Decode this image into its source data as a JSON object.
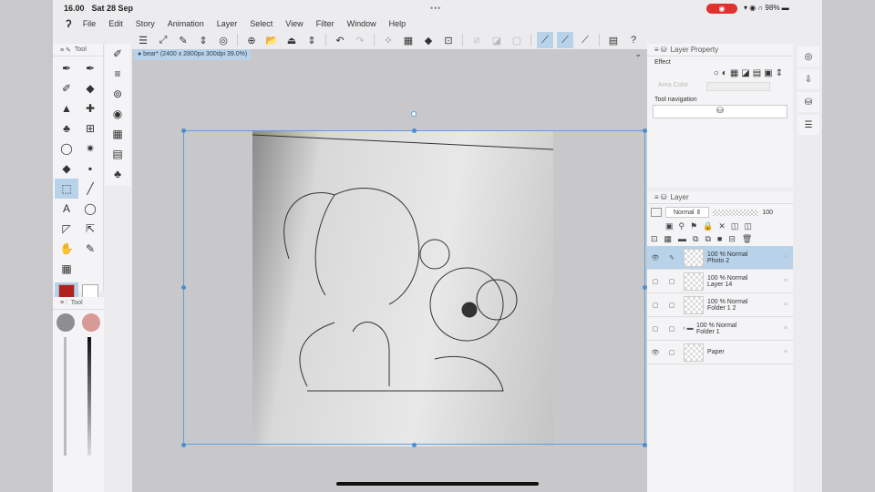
{
  "status": {
    "time": "16.00",
    "date": "Sat 28 Sep",
    "dots": "•••",
    "battery": "98%",
    "record": "◉"
  },
  "menu": [
    "File",
    "Edit",
    "Story",
    "Animation",
    "Layer",
    "Select",
    "View",
    "Filter",
    "Window",
    "Help"
  ],
  "toolbar": [
    "☰",
    "⤢",
    "✎",
    "⇕",
    "◎",
    "⊕",
    "📂",
    "⏏",
    "⇕",
    "↶",
    "↷",
    "⁘",
    "▦",
    "◆",
    "⊡",
    "⧄",
    "◪",
    "▢",
    "⟋",
    "⟋",
    "⟋",
    "▤",
    "?"
  ],
  "tool_panel": {
    "tab": "Tool",
    "tools": [
      "✒",
      "✒",
      "✐",
      "◆",
      "▲",
      "✚",
      "♣",
      "⊞",
      "◯",
      "✷",
      "◆",
      "▪",
      "⬚",
      "╱",
      "A",
      "◯",
      "◸",
      "⇱",
      "✋",
      "✎"
    ],
    "main_color": "#b0221e",
    "sub_color": "#ffffff"
  },
  "subtools": [
    "✐",
    "≡",
    "⊚",
    "◉",
    "▦",
    "▤",
    "♣"
  ],
  "tool_prop": {
    "tab": "Tool",
    "color1": "#8e8e90",
    "color2": "#d89a96"
  },
  "doc_tab": "● bear* (2400 x 2800px 300dpi 39.0%)",
  "layer_property": {
    "title": "Layer Property",
    "effect": "Effect",
    "area_color": "Area Color",
    "tool_navigation": "Tool navigation"
  },
  "layer_panel": {
    "title": "Layer",
    "blend": "Normal",
    "opacity": "100",
    "layers": [
      {
        "opacity": "100 %",
        "mode": "Normal",
        "name": "Photo 2",
        "selected": true,
        "visible": "👁"
      },
      {
        "opacity": "100 %",
        "mode": "Normal",
        "name": "Layer 14"
      },
      {
        "opacity": "100 %",
        "mode": "Normal",
        "name": "Folder 1 2"
      },
      {
        "opacity": "100 %",
        "mode": "Normal",
        "name": "Folder 1"
      },
      {
        "opacity": "",
        "mode": "",
        "name": "Paper",
        "visible": "👁"
      }
    ]
  }
}
